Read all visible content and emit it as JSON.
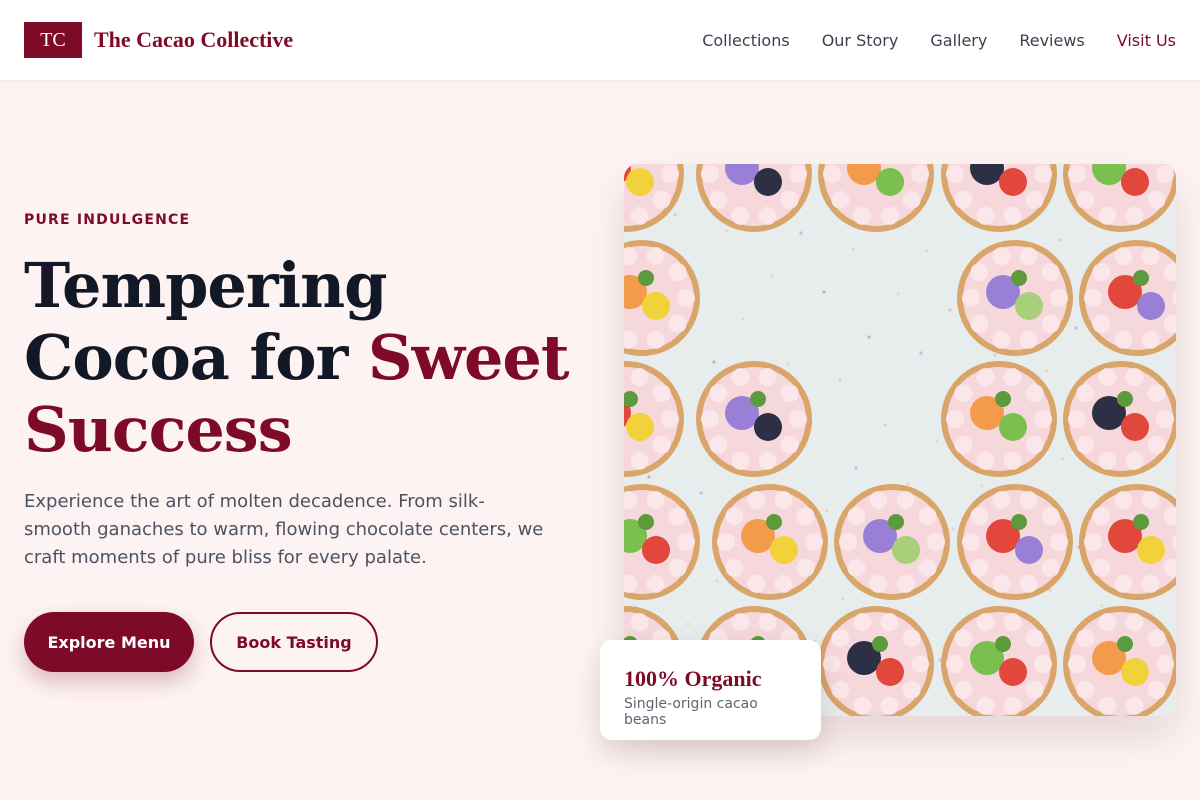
{
  "brand": {
    "mark": "TC",
    "name": "The Cacao Collective"
  },
  "nav": {
    "items": [
      "Collections",
      "Our Story",
      "Gallery",
      "Reviews"
    ],
    "cta": "Visit Us"
  },
  "hero": {
    "eyebrow": "PURE INDULGENCE",
    "headline_part1": "Tempering Cocoa for ",
    "headline_highlight": "Sweet Success",
    "lead": "Experience the art of molten decadence. From silk-smooth ganaches to warm, flowing chocolate centers, we craft moments of pure bliss for every palate.",
    "primary_cta": "Explore Menu",
    "secondary_cta": "Book Tasting",
    "image_alt": "Fruit-topped tartlets arranged on a pale tray"
  },
  "badge": {
    "title": "100% Organic",
    "subtitle": "Single-origin cacao beans"
  },
  "colors": {
    "accent": "#7d0a27",
    "page_bg": "#fdf3f2",
    "heading": "#121826",
    "body_text": "#4b5262"
  }
}
